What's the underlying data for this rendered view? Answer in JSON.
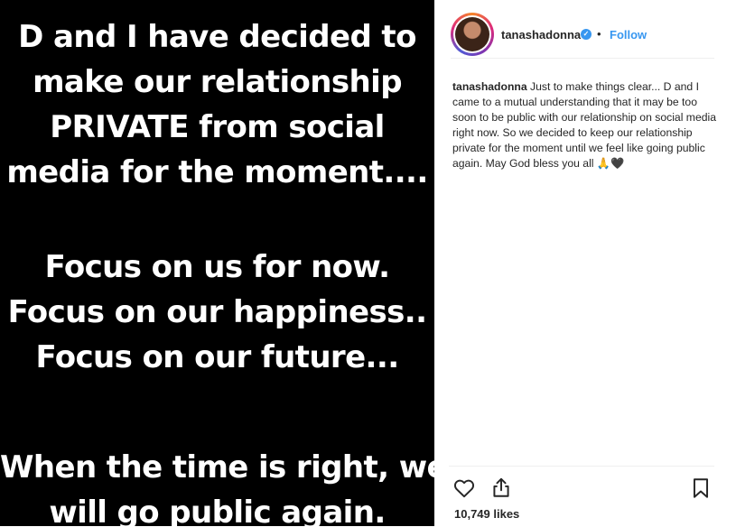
{
  "story": {
    "paragraph1": "D and I have decided to\nmake our relationship\nPRIVATE from social\nmedia for the moment....",
    "paragraph2": "Focus on us for now.\nFocus on our happiness..\nFocus on our future...",
    "paragraph3": "When the time is right, we\nwill go public again."
  },
  "post": {
    "username": "tanashadonna",
    "verified_icon": "verified-badge-icon",
    "separator": "•",
    "follow_label": "Follow",
    "caption_user": "tanashadonna",
    "caption_text": "Just to make things clear... D and I came to a mutual understanding that it may be too soon to be public with our relationship on social media right now. So we decided to keep our relationship private for the moment until we feel like going public again. May God bless you all 🙏🖤",
    "likes": "10,749 likes"
  },
  "icons": {
    "like": "heart-icon",
    "share": "share-icon",
    "save": "bookmark-icon"
  },
  "colors": {
    "story_background": "#000000",
    "link_blue": "#3897f0",
    "text": "#262626"
  }
}
